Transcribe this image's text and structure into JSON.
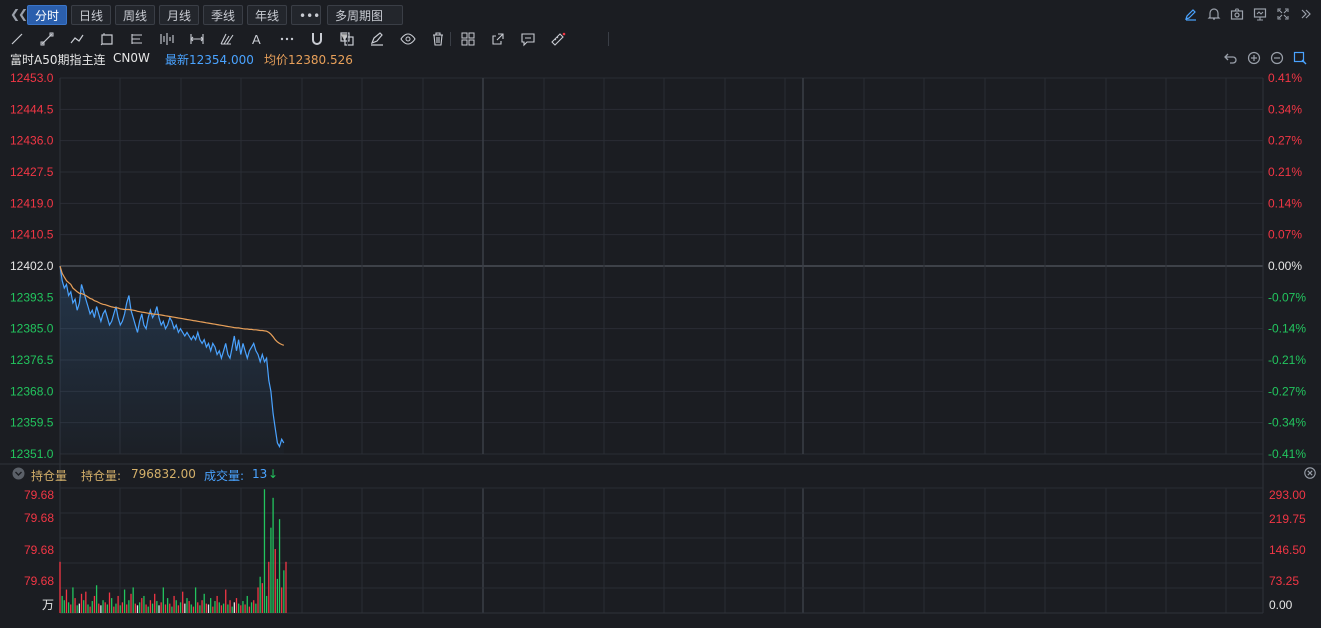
{
  "tabs": [
    {
      "label": "分时",
      "active": true
    },
    {
      "label": "日线",
      "active": false
    },
    {
      "label": "周线",
      "active": false
    },
    {
      "label": "月线",
      "active": false
    },
    {
      "label": "季线",
      "active": false
    },
    {
      "label": "年线",
      "active": false
    },
    {
      "label": "•••",
      "active": false
    },
    {
      "label": "多周期图",
      "active": false,
      "dropdown": true
    }
  ],
  "top_icons": [
    "pencil-icon",
    "bell-icon",
    "camera-icon",
    "screen-icon",
    "fullscreen-icon",
    "expand-right-icon"
  ],
  "tools": [
    "line-tool-icon",
    "ray-tool-icon",
    "polyline-tool-icon",
    "shape-tool-icon",
    "fib-tool-icon",
    "parallel-tool-icon",
    "measure-tool-icon",
    "pitchfork-tool-icon",
    "text-tool-icon",
    "more-tools-icon",
    "magnet-icon",
    "layers-icon",
    "eraser-icon",
    "eye-icon",
    "trash-icon",
    "template-icon",
    "export-icon",
    "comment-icon",
    "ruler-icon"
  ],
  "info": {
    "instrument": "富时A50期指主连",
    "code": "CN0W",
    "latest_label": "最新",
    "latest": "12354.000",
    "avg_label": "均价",
    "avg": "12380.526"
  },
  "colors": {
    "price_line": "#4aa3ff",
    "avg_line": "#e8a05a",
    "up": "#f23645",
    "down": "#22c55e",
    "neutral": "#e6e6e6",
    "grid": "#2a2d34",
    "vol_label": "#d4b06a",
    "turnover_label": "#4aa3ff"
  },
  "subchart": {
    "title": "持仓量",
    "oi_label": "持仓量:",
    "oi_value": "796832.00",
    "vol_label": "成交量:",
    "vol_value": "13",
    "unit": "万",
    "left_ticks": [
      "79.68",
      "79.68",
      "79.68",
      "79.68"
    ],
    "right_ticks": [
      "293.00",
      "219.75",
      "146.50",
      "73.25",
      "0.00"
    ]
  },
  "chart_data": {
    "type": "line",
    "prev_close": 12402.0,
    "ylim": [
      12351.0,
      12453.0
    ],
    "y_ticks_left": [
      "12453.0",
      "12444.5",
      "12436.0",
      "12427.5",
      "12419.0",
      "12410.5",
      "12402.0",
      "12393.5",
      "12385.0",
      "12376.5",
      "12368.0",
      "12359.5",
      "12351.0"
    ],
    "y_ticks_right": [
      "0.41%",
      "0.34%",
      "0.27%",
      "0.21%",
      "0.14%",
      "0.07%",
      "0.00%",
      "-0.07%",
      "-0.14%",
      "-0.21%",
      "-0.27%",
      "-0.34%",
      "-0.41%"
    ],
    "session_minutes": 400,
    "series": [
      {
        "key": "price",
        "minute": [
          0,
          2,
          4,
          6,
          8,
          10,
          12,
          14,
          16,
          18,
          20,
          22,
          24,
          26,
          28,
          30,
          32,
          34,
          36,
          38,
          40,
          42,
          44,
          46,
          48,
          50,
          52,
          54,
          56,
          58,
          60,
          62,
          64,
          66,
          68,
          70,
          72,
          74,
          76,
          78,
          80,
          82,
          84,
          86,
          88,
          90,
          92,
          94,
          96,
          98,
          100,
          102,
          104,
          106,
          108,
          110,
          112,
          114,
          116,
          118,
          120,
          122,
          124,
          126,
          128,
          130,
          132,
          134,
          136,
          138,
          140,
          142,
          144,
          146,
          148,
          150,
          152,
          154,
          156,
          158,
          160,
          162,
          164,
          166,
          168,
          170,
          172,
          174,
          176,
          178,
          180,
          182,
          184,
          186,
          188,
          190,
          192,
          194,
          196,
          198,
          200,
          202,
          204,
          206,
          208,
          210,
          212,
          214,
          216,
          218,
          220,
          222,
          224,
          226,
          228,
          230,
          232,
          234,
          236,
          238,
          240,
          242,
          244,
          246,
          248,
          250,
          252,
          254,
          256,
          258,
          260,
          262,
          264,
          266,
          268,
          270,
          272,
          274,
          276,
          278,
          280,
          282,
          284,
          286,
          288,
          290,
          292,
          294,
          296,
          298,
          300,
          302,
          304,
          306,
          308,
          310,
          312,
          314,
          316,
          318,
          320,
          322,
          324,
          326,
          328,
          330,
          332,
          334,
          336,
          338,
          340,
          342,
          344,
          346,
          348,
          350,
          352,
          354,
          356,
          358,
          360,
          362,
          364,
          366,
          368,
          370,
          372,
          374,
          376,
          378,
          380,
          382,
          384,
          386,
          388,
          390,
          392,
          394,
          396,
          398,
          400,
          402,
          404,
          406,
          408,
          410,
          412,
          414,
          416,
          418,
          420,
          422,
          424,
          426,
          428,
          430,
          432,
          434,
          436,
          438,
          440,
          442,
          444,
          446,
          448,
          450,
          452,
          454,
          456,
          458,
          460,
          462,
          464,
          466,
          468,
          470,
          472,
          474,
          476,
          478,
          480,
          482,
          484,
          486,
          488,
          490,
          492,
          494,
          496,
          498,
          500,
          502,
          504,
          506,
          508,
          510,
          512,
          514,
          516,
          518,
          520,
          522,
          524,
          526,
          528,
          530,
          532,
          534,
          536,
          538,
          540,
          542,
          544,
          546,
          548,
          550,
          552,
          554,
          556,
          558,
          560,
          562,
          564,
          566,
          568,
          570,
          572,
          574,
          576,
          578,
          580,
          582,
          584,
          586,
          588,
          590,
          592,
          594,
          596,
          598,
          600,
          602,
          604,
          606,
          608,
          610,
          612,
          614,
          616,
          618,
          620,
          622,
          624,
          626,
          628,
          630,
          632,
          634,
          636,
          638,
          640,
          642,
          644,
          646,
          648,
          650,
          652,
          654,
          656,
          658,
          660,
          662,
          664,
          666,
          668,
          670,
          672,
          674,
          676,
          678,
          680,
          682,
          684,
          686,
          688,
          690,
          692,
          694,
          696,
          698,
          700,
          702,
          704,
          706,
          708,
          710,
          712,
          714,
          716,
          718,
          720,
          722,
          724,
          726,
          728,
          730,
          732,
          734,
          736,
          738,
          740,
          742,
          744,
          746,
          748,
          750,
          752,
          754,
          756,
          758,
          760,
          762,
          764,
          766,
          768,
          770,
          772,
          774,
          776,
          778,
          780,
          782,
          784,
          786,
          788,
          790,
          792,
          794,
          796,
          798,
          800,
          802,
          804,
          806,
          808,
          810,
          812,
          814,
          816,
          818,
          820,
          822,
          824,
          826,
          828,
          830,
          832,
          834,
          836,
          838,
          840,
          842,
          844,
          846,
          848,
          850,
          852,
          854,
          856,
          858,
          860,
          862,
          864,
          866,
          868,
          870,
          872,
          874,
          876,
          878,
          880,
          882,
          884,
          886,
          888,
          890,
          892,
          894,
          896,
          898,
          900,
          902,
          904,
          906,
          908,
          910,
          912,
          914,
          916,
          918,
          920,
          922,
          924,
          926,
          928,
          930,
          932,
          934,
          936,
          938,
          940,
          942,
          944,
          946,
          948,
          950,
          952,
          954,
          956,
          958,
          960,
          962,
          964,
          966,
          968,
          970,
          972,
          974,
          976,
          978,
          980,
          982,
          984,
          986,
          988,
          990,
          992,
          994,
          996,
          998,
          1000,
          1002,
          1004,
          1006,
          1008,
          1010,
          1012,
          1014,
          1016,
          1018,
          1020,
          1022,
          1024,
          1026,
          1028,
          1030,
          1032,
          1034,
          1036,
          1038,
          1040,
          1042,
          1044,
          1046,
          1048,
          1050,
          1052,
          1054,
          1056,
          1058,
          1060,
          1062,
          1064,
          1066,
          1068,
          1070,
          1072,
          1074,
          1076,
          1078,
          1080,
          1082,
          1084,
          1086,
          1088,
          1090,
          1092,
          1094,
          1096,
          1098,
          1100,
          1102,
          1104,
          1106,
          1108,
          1110,
          1112,
          1114,
          1116,
          1118,
          1120,
          1122,
          1124,
          1126,
          1128,
          1130,
          1132,
          1134,
          1136,
          1138,
          1140,
          1142,
          1144,
          1146,
          1148,
          1150,
          1152,
          1154,
          1156,
          1158,
          1160,
          1162,
          1164,
          1166,
          1168,
          1170,
          1172,
          1174,
          1176,
          1178,
          1180,
          1182,
          1184,
          1186,
          1188,
          1190,
          1192,
          1194,
          1196,
          1198,
          1200,
          1202,
          1204,
          1206,
          1208,
          1210,
          1212,
          1214,
          1216,
          1218,
          1220,
          1222,
          1224,
          1226,
          1228,
          1230,
          1232,
          1234,
          1236,
          1238,
          1240,
          1242,
          1244,
          1246,
          1248,
          1250,
          1252,
          1254,
          1256,
          1258,
          1260,
          1262,
          1264,
          1266,
          1268,
          1270,
          1272,
          1274,
          1276,
          1278,
          1280,
          1282,
          1284,
          1286,
          1288,
          1290,
          1292,
          1294,
          1296,
          1298
        ],
        "values": []
      }
    ],
    "price": [
      12402,
      12398,
      12396,
      12397,
      12394,
      12395,
      12392,
      12393,
      12390,
      12392,
      12397,
      12395,
      12393,
      12391,
      12389,
      12390,
      12388,
      12391,
      12389,
      12387,
      12389,
      12390,
      12388,
      12386,
      12387,
      12389,
      12391,
      12388,
      12386,
      12387,
      12389,
      12392,
      12394,
      12390,
      12388,
      12386,
      12384,
      12387,
      12389,
      12386,
      12385,
      12388,
      12390,
      12388,
      12389,
      12391,
      12388,
      12386,
      12387,
      12385,
      12386,
      12388,
      12387,
      12385,
      12386,
      12384,
      12385,
      12384,
      12383,
      12384,
      12383,
      12382,
      12383,
      12382,
      12384,
      12382,
      12381,
      12382,
      12380,
      12381,
      12379,
      12381,
      12380,
      12378,
      12379,
      12377,
      12379,
      12381,
      12378,
      12377,
      12380,
      12383,
      12379,
      12382,
      12378,
      12381,
      12379,
      12377,
      12379,
      12380,
      12381,
      12379,
      12378,
      12376,
      12378,
      12376,
      12377,
      12371,
      12368,
      12362,
      12358,
      12354,
      12353,
      12355,
      12354
    ],
    "avg": [
      12402,
      12400,
      12399,
      12398,
      12397.5,
      12397,
      12396,
      12395.5,
      12395,
      12394.6,
      12394.5,
      12394.3,
      12394,
      12393.6,
      12393.2,
      12393,
      12392.6,
      12392.4,
      12392.1,
      12391.8,
      12391.6,
      12391.5,
      12391.3,
      12391.1,
      12390.9,
      12390.8,
      12390.7,
      12390.6,
      12390.4,
      12390.3,
      12390.2,
      12390.2,
      12390.2,
      12390.1,
      12390,
      12389.9,
      12389.7,
      12389.6,
      12389.5,
      12389.4,
      12389.3,
      12389.2,
      12389.1,
      12389,
      12388.9,
      12388.9,
      12388.8,
      12388.7,
      12388.6,
      12388.5,
      12388.4,
      12388.3,
      12388.2,
      12388.1,
      12388,
      12387.9,
      12387.8,
      12387.7,
      12387.6,
      12387.5,
      12387.4,
      12387.3,
      12387.2,
      12387.1,
      12387,
      12386.9,
      12386.8,
      12386.7,
      12386.6,
      12386.5,
      12386.4,
      12386.3,
      12386.2,
      12386.1,
      12386,
      12385.9,
      12385.8,
      12385.7,
      12385.6,
      12385.5,
      12385.4,
      12385.3,
      12385.2,
      12385.2,
      12385.1,
      12385,
      12384.9,
      12384.9,
      12384.8,
      12384.8,
      12384.7,
      12384.7,
      12384.6,
      12384.5,
      12384.5,
      12384.4,
      12384.3,
      12384,
      12383.5,
      12382.8,
      12382,
      12381.4,
      12381,
      12380.7,
      12380.5
    ],
    "volume": [
      120,
      40,
      30,
      55,
      25,
      20,
      60,
      35,
      18,
      22,
      45,
      30,
      50,
      20,
      15,
      28,
      40,
      65,
      22,
      18,
      30,
      25,
      20,
      48,
      35,
      15,
      22,
      40,
      18,
      25,
      55,
      20,
      30,
      45,
      60,
      22,
      18,
      25,
      35,
      40,
      20,
      15,
      30,
      22,
      45,
      28,
      18,
      25,
      60,
      20,
      35,
      22,
      15,
      40,
      30,
      18,
      25,
      50,
      22,
      35,
      28,
      20,
      15,
      60,
      25,
      18,
      30,
      45,
      22,
      20,
      35,
      15,
      28,
      40,
      25,
      18,
      22,
      55,
      20,
      30,
      15,
      25,
      35,
      22,
      18,
      28,
      20,
      40,
      15,
      25,
      30,
      22,
      60,
      85,
      70,
      290,
      40,
      120,
      200,
      270,
      150,
      80,
      220,
      60,
      100,
      120
    ],
    "volume_color": [
      "up",
      "down",
      "down",
      "up",
      "down",
      "up",
      "down",
      "up",
      "down",
      "neutral",
      "up",
      "down",
      "up",
      "down",
      "up",
      "down",
      "up",
      "down",
      "up",
      "neutral",
      "down",
      "up",
      "down",
      "up",
      "down",
      "up",
      "down",
      "up",
      "down",
      "up",
      "down",
      "up",
      "down",
      "up",
      "down",
      "up",
      "neutral",
      "down",
      "up",
      "down",
      "up",
      "down",
      "up",
      "down",
      "up",
      "down",
      "neutral",
      "up",
      "down",
      "up",
      "down",
      "up",
      "down",
      "up",
      "down",
      "up",
      "down",
      "up",
      "neutral",
      "down",
      "up",
      "down",
      "up",
      "down",
      "up",
      "down",
      "up",
      "down",
      "up",
      "neutral",
      "down",
      "up",
      "down",
      "up",
      "down",
      "up",
      "down",
      "up",
      "down",
      "up",
      "down",
      "neutral",
      "up",
      "down",
      "up",
      "down",
      "up",
      "down",
      "up",
      "down",
      "up",
      "down",
      "up",
      "down",
      "up",
      "down",
      "down",
      "up",
      "down",
      "down",
      "up",
      "down",
      "down",
      "up",
      "down",
      "up"
    ]
  }
}
